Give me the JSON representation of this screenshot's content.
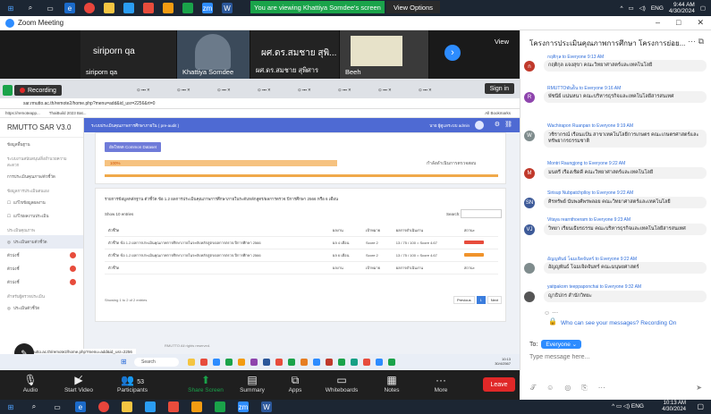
{
  "top_taskbar": {
    "share_banner": "You are viewing Khattiya Somdee's screen",
    "view_options": "View Options",
    "lang": "ENG",
    "time": "9:44 AM",
    "date": "4/30/2024"
  },
  "zoom_window": {
    "title": "Zoom Meeting"
  },
  "video_tiles": [
    {
      "name": "siriporn qa",
      "sub": "siriporn qa"
    },
    {
      "name": "",
      "sub": "Khattiya Somdee"
    },
    {
      "name": "ผศ.ดร.สมชาย สุพิ...",
      "sub": "ผศ.ดร.สมชาย สุพิศาร"
    },
    {
      "name": "",
      "sub": "Beeh"
    }
  ],
  "view_label": "View",
  "shared_screen": {
    "recording_label": "Recording",
    "signin_label": "Sign in",
    "url": "sar.rmutto.ac.th/remote2/home.php?menu=add&id_usr=2256&rt=0",
    "bookmark_1": "https://remoteapp...",
    "bookmark_2": "ThaiBuild 2023 Bat...",
    "all_bookmarks": "All Bookmarks",
    "sar_brand": "RMUTTO SAR V3.0",
    "header_text": "ระบบประเมินคุณภาพการศึกษาภายใน ( pre-audit )",
    "header_user": "นาย ผู้ดูแลระบบ admin",
    "side_items": [
      {
        "label": "ข้อมูลพื้นฐาน"
      },
      {
        "label": "ระบบงานสนับสนุน/สิ่งอำนวยความสะดวก"
      },
      {
        "label": "การประเมินคุณภาพ/ตัวชี้วัด"
      },
      {
        "label": "ข้อมูลการประเมินตนเอง"
      },
      {
        "label": "แก้ไขข้อมูลผลงาน"
      },
      {
        "label": "แก้ไขผลงานประเมิน"
      },
      {
        "label": "ประเมินคุณภาพ"
      },
      {
        "label": "ประเมินตามตัวชี้วัด"
      },
      {
        "label": "ตัวบ่งชี้"
      },
      {
        "label": "ตัวบ่งชี้"
      },
      {
        "label": "ตัวบ่งชี้"
      },
      {
        "label": "สำหรับผู้ตรวจประเมิน"
      },
      {
        "label": "ประเมินตัวชี้วัด"
      }
    ],
    "upload_button": "อัพโหลด Common Dataset",
    "progress": {
      "label": "100%",
      "value": 100,
      "status": "กำลังดำเนินการตรวจสอบ"
    },
    "section_title": "รายการข้อมูลหลักฐาน ตัวชี้วัด ข้อ 1.2 ผลการประเมินคุณภาพการศึกษาภายในระดับหลักสูตร/ผลการตรวจ ปีการศึกษา 2566 หรือ 6 เดือน",
    "show_label": "Show 10 entries",
    "search_label": "Search:",
    "table_headers": [
      "ตัวชี้วัด",
      "ผลงาน",
      "เป้าหมาย",
      "ผลการดำเนินงาน",
      "สถานะ"
    ],
    "table_rows": [
      {
        "c1": "ตัวชี้วัด ข้อ 1.2 ผลการประเมินคุณภาพการศึกษาภายในระดับหลักสูตร/ผลการตรวจ ปีการศึกษา 2566",
        "c2": "ผล 4 เดือน",
        "c3": "Score 2",
        "c4": "13 / 75 / 100 = Score 4.67",
        "status_color": "#e74c3c"
      },
      {
        "c1": "ตัวชี้วัด ข้อ 1.2 ผลการประเมินคุณภาพการศึกษาภายในระดับหลักสูตร/ผลการตรวจ ปีการศึกษา 2566",
        "c2": "ผล 6 เดือน",
        "c3": "Score 2",
        "c4": "13 / 75 / 100 = Score 4.67",
        "status_color": "#f0932b"
      }
    ],
    "table_footer": [
      "ตัวชี้วัด",
      "ผลงาน",
      "เป้าหมาย",
      "ผลการดำเนินงาน",
      "สถานะ"
    ],
    "entries_info": "Showing 1 to 2 of 2 entries",
    "pager_prev": "Previous",
    "pager_cur": "1",
    "pager_next": "Next",
    "footer_url": "sar.rmutto.ac.th/remote2/home.php?menu=add&id_usr=2256",
    "copyright": "RMUTTO  All rights reserved.",
    "inner_search": "Search",
    "inner_clock_time": "10:13",
    "inner_clock_date": "30/4/2567"
  },
  "chat": {
    "title": "โครงการประเมินคุณภาพการศึกษา โครงการย่อย...",
    "messages": [
      {
        "meta": "กฤติกุล to Everyone 9:13 AM",
        "text": "กฤติกุล แจงสุขา คณะวิทยาศาสตร์และเทคโนโลยี",
        "color": "#c0392b"
      },
      {
        "meta": "RMUTTOพันธ์ิน to Everyone 9:16 AM",
        "text": "พัชนีย์ แน่นหนา คณะบริหารธุรกิจและเทคโนโลยีสารสนเทศ",
        "color": "#8e44ad"
      },
      {
        "meta": "Wachirapon Ruanpan to Everyone 9:19 AM",
        "text": "วชิรากรณ์ เรือนแป้น สาขาเทคโนโลยีการเกษตร คณะเกษตรศาสตร์และทรัพยากรธรรมชาติ",
        "color": "#7f8c8d"
      },
      {
        "meta": "Montri Raungjong to Everyone 9:22 AM",
        "text": "มนตรี เรืองเชิดดี คณะวิทยาศาสตร์และเทคโนโลยี",
        "color": "#c0392b"
      },
      {
        "meta": "Sirisup Nubpatchplloy to Everyone 9:22 AM",
        "text": "ศิรทรัพย์ นับพงศ์พรพลอย คณะวิทยาศาสตร์และเทคโนโลยี",
        "color": "#3d5a98"
      },
      {
        "meta": "Vitaya rearnthoeram to Everyone 9:23 AM",
        "text": "วิทยา เรียนเธียรธรรม คณะบริหารธุรกิจและเทคโนโลยีสารสนเทศ",
        "color": "#3d5a98"
      },
      {
        "meta": "อัญญพันธ์ โฉมเจิดจันทร์ to Everyone 9:22 AM",
        "text": "อัญญพันธ์ โฉมเจิดจันทร์ คณะมนุษยศาสตร์",
        "color": "#7f8c8d"
      },
      {
        "meta": "yaitpakorn teeppaponchai to Everyone 9:32 AM",
        "text": "ญาธิปกร สำนักวิทยะ",
        "color": "#555555"
      }
    ],
    "who_can_see": "Who can see your messages? Recording On",
    "to_label": "To:",
    "to_value": "Everyone",
    "placeholder": "Type message here..."
  },
  "zoom_toolbar": {
    "audio": "Audio",
    "video": "Start Video",
    "participants": "Participants",
    "participants_count": "53",
    "share": "Share Screen",
    "summary": "Summary",
    "apps": "Apps",
    "whiteboards": "Whiteboards",
    "notes": "Notes",
    "more": "More",
    "leave": "Leave"
  },
  "bottom_taskbar": {
    "lang": "ENG",
    "time": "10:13 AM",
    "date": "4/30/2024"
  }
}
